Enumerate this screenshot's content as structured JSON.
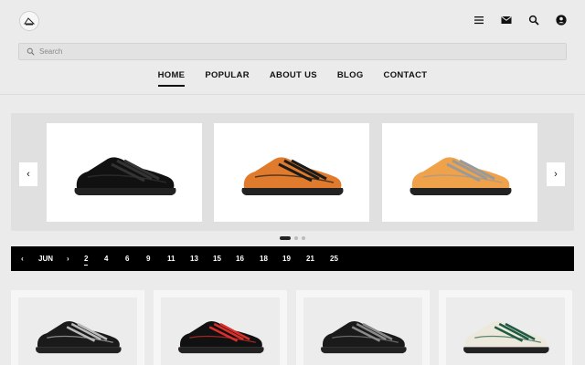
{
  "header": {
    "logo_icon": "brand-logo-icon",
    "icons": [
      "menu-icon",
      "mail-icon",
      "search-icon",
      "account-icon"
    ]
  },
  "search": {
    "placeholder": "Search",
    "value": ""
  },
  "nav": {
    "items": [
      {
        "label": "HOME",
        "active": true
      },
      {
        "label": "POPULAR",
        "active": false
      },
      {
        "label": "ABOUT US",
        "active": false
      },
      {
        "label": "BLOG",
        "active": false
      },
      {
        "label": "CONTACT",
        "active": false
      }
    ]
  },
  "carousel": {
    "prev_label": "‹",
    "next_label": "›",
    "slides": [
      {
        "color": "#111111",
        "accent": "#333333"
      },
      {
        "color": "#e07b2e",
        "accent": "#1b1b1b"
      },
      {
        "color": "#f0a24a",
        "accent": "#9a9a9a"
      }
    ],
    "page_count": 3,
    "active_page": 1
  },
  "datebar": {
    "prev_label": "‹",
    "month": "JUN",
    "next_label": "›",
    "days": [
      "2",
      "4",
      "6",
      "9",
      "11",
      "13",
      "15",
      "16",
      "18",
      "19",
      "21",
      "25"
    ],
    "active_day": "2"
  },
  "products": [
    {
      "color": "#1a1a1a",
      "accent": "#bbbbbb"
    },
    {
      "color": "#111111",
      "accent": "#d9302c"
    },
    {
      "color": "#1a1a1a",
      "accent": "#8a8a8a"
    },
    {
      "color": "#ece8dc",
      "accent": "#1f5b43"
    }
  ]
}
